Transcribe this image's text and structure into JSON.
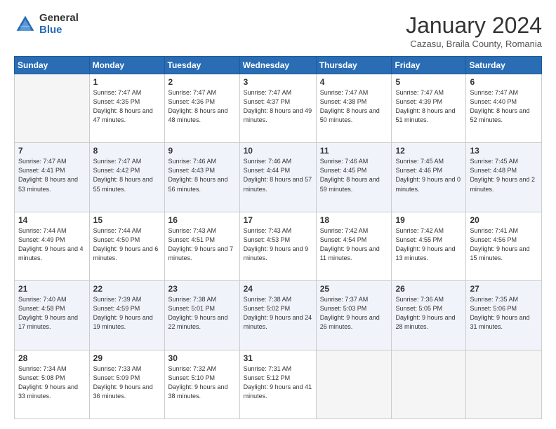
{
  "header": {
    "logo_general": "General",
    "logo_blue": "Blue",
    "title": "January 2024",
    "subtitle": "Cazasu, Braila County, Romania"
  },
  "days_of_week": [
    "Sunday",
    "Monday",
    "Tuesday",
    "Wednesday",
    "Thursday",
    "Friday",
    "Saturday"
  ],
  "weeks": [
    [
      {
        "num": "",
        "empty": true
      },
      {
        "num": "1",
        "sunrise": "Sunrise: 7:47 AM",
        "sunset": "Sunset: 4:35 PM",
        "daylight": "Daylight: 8 hours and 47 minutes."
      },
      {
        "num": "2",
        "sunrise": "Sunrise: 7:47 AM",
        "sunset": "Sunset: 4:36 PM",
        "daylight": "Daylight: 8 hours and 48 minutes."
      },
      {
        "num": "3",
        "sunrise": "Sunrise: 7:47 AM",
        "sunset": "Sunset: 4:37 PM",
        "daylight": "Daylight: 8 hours and 49 minutes."
      },
      {
        "num": "4",
        "sunrise": "Sunrise: 7:47 AM",
        "sunset": "Sunset: 4:38 PM",
        "daylight": "Daylight: 8 hours and 50 minutes."
      },
      {
        "num": "5",
        "sunrise": "Sunrise: 7:47 AM",
        "sunset": "Sunset: 4:39 PM",
        "daylight": "Daylight: 8 hours and 51 minutes."
      },
      {
        "num": "6",
        "sunrise": "Sunrise: 7:47 AM",
        "sunset": "Sunset: 4:40 PM",
        "daylight": "Daylight: 8 hours and 52 minutes."
      }
    ],
    [
      {
        "num": "7",
        "sunrise": "Sunrise: 7:47 AM",
        "sunset": "Sunset: 4:41 PM",
        "daylight": "Daylight: 8 hours and 53 minutes."
      },
      {
        "num": "8",
        "sunrise": "Sunrise: 7:47 AM",
        "sunset": "Sunset: 4:42 PM",
        "daylight": "Daylight: 8 hours and 55 minutes."
      },
      {
        "num": "9",
        "sunrise": "Sunrise: 7:46 AM",
        "sunset": "Sunset: 4:43 PM",
        "daylight": "Daylight: 8 hours and 56 minutes."
      },
      {
        "num": "10",
        "sunrise": "Sunrise: 7:46 AM",
        "sunset": "Sunset: 4:44 PM",
        "daylight": "Daylight: 8 hours and 57 minutes."
      },
      {
        "num": "11",
        "sunrise": "Sunrise: 7:46 AM",
        "sunset": "Sunset: 4:45 PM",
        "daylight": "Daylight: 8 hours and 59 minutes."
      },
      {
        "num": "12",
        "sunrise": "Sunrise: 7:45 AM",
        "sunset": "Sunset: 4:46 PM",
        "daylight": "Daylight: 9 hours and 0 minutes."
      },
      {
        "num": "13",
        "sunrise": "Sunrise: 7:45 AM",
        "sunset": "Sunset: 4:48 PM",
        "daylight": "Daylight: 9 hours and 2 minutes."
      }
    ],
    [
      {
        "num": "14",
        "sunrise": "Sunrise: 7:44 AM",
        "sunset": "Sunset: 4:49 PM",
        "daylight": "Daylight: 9 hours and 4 minutes."
      },
      {
        "num": "15",
        "sunrise": "Sunrise: 7:44 AM",
        "sunset": "Sunset: 4:50 PM",
        "daylight": "Daylight: 9 hours and 6 minutes."
      },
      {
        "num": "16",
        "sunrise": "Sunrise: 7:43 AM",
        "sunset": "Sunset: 4:51 PM",
        "daylight": "Daylight: 9 hours and 7 minutes."
      },
      {
        "num": "17",
        "sunrise": "Sunrise: 7:43 AM",
        "sunset": "Sunset: 4:53 PM",
        "daylight": "Daylight: 9 hours and 9 minutes."
      },
      {
        "num": "18",
        "sunrise": "Sunrise: 7:42 AM",
        "sunset": "Sunset: 4:54 PM",
        "daylight": "Daylight: 9 hours and 11 minutes."
      },
      {
        "num": "19",
        "sunrise": "Sunrise: 7:42 AM",
        "sunset": "Sunset: 4:55 PM",
        "daylight": "Daylight: 9 hours and 13 minutes."
      },
      {
        "num": "20",
        "sunrise": "Sunrise: 7:41 AM",
        "sunset": "Sunset: 4:56 PM",
        "daylight": "Daylight: 9 hours and 15 minutes."
      }
    ],
    [
      {
        "num": "21",
        "sunrise": "Sunrise: 7:40 AM",
        "sunset": "Sunset: 4:58 PM",
        "daylight": "Daylight: 9 hours and 17 minutes."
      },
      {
        "num": "22",
        "sunrise": "Sunrise: 7:39 AM",
        "sunset": "Sunset: 4:59 PM",
        "daylight": "Daylight: 9 hours and 19 minutes."
      },
      {
        "num": "23",
        "sunrise": "Sunrise: 7:38 AM",
        "sunset": "Sunset: 5:01 PM",
        "daylight": "Daylight: 9 hours and 22 minutes."
      },
      {
        "num": "24",
        "sunrise": "Sunrise: 7:38 AM",
        "sunset": "Sunset: 5:02 PM",
        "daylight": "Daylight: 9 hours and 24 minutes."
      },
      {
        "num": "25",
        "sunrise": "Sunrise: 7:37 AM",
        "sunset": "Sunset: 5:03 PM",
        "daylight": "Daylight: 9 hours and 26 minutes."
      },
      {
        "num": "26",
        "sunrise": "Sunrise: 7:36 AM",
        "sunset": "Sunset: 5:05 PM",
        "daylight": "Daylight: 9 hours and 28 minutes."
      },
      {
        "num": "27",
        "sunrise": "Sunrise: 7:35 AM",
        "sunset": "Sunset: 5:06 PM",
        "daylight": "Daylight: 9 hours and 31 minutes."
      }
    ],
    [
      {
        "num": "28",
        "sunrise": "Sunrise: 7:34 AM",
        "sunset": "Sunset: 5:08 PM",
        "daylight": "Daylight: 9 hours and 33 minutes."
      },
      {
        "num": "29",
        "sunrise": "Sunrise: 7:33 AM",
        "sunset": "Sunset: 5:09 PM",
        "daylight": "Daylight: 9 hours and 36 minutes."
      },
      {
        "num": "30",
        "sunrise": "Sunrise: 7:32 AM",
        "sunset": "Sunset: 5:10 PM",
        "daylight": "Daylight: 9 hours and 38 minutes."
      },
      {
        "num": "31",
        "sunrise": "Sunrise: 7:31 AM",
        "sunset": "Sunset: 5:12 PM",
        "daylight": "Daylight: 9 hours and 41 minutes."
      },
      {
        "num": "",
        "empty": true
      },
      {
        "num": "",
        "empty": true
      },
      {
        "num": "",
        "empty": true
      }
    ]
  ]
}
